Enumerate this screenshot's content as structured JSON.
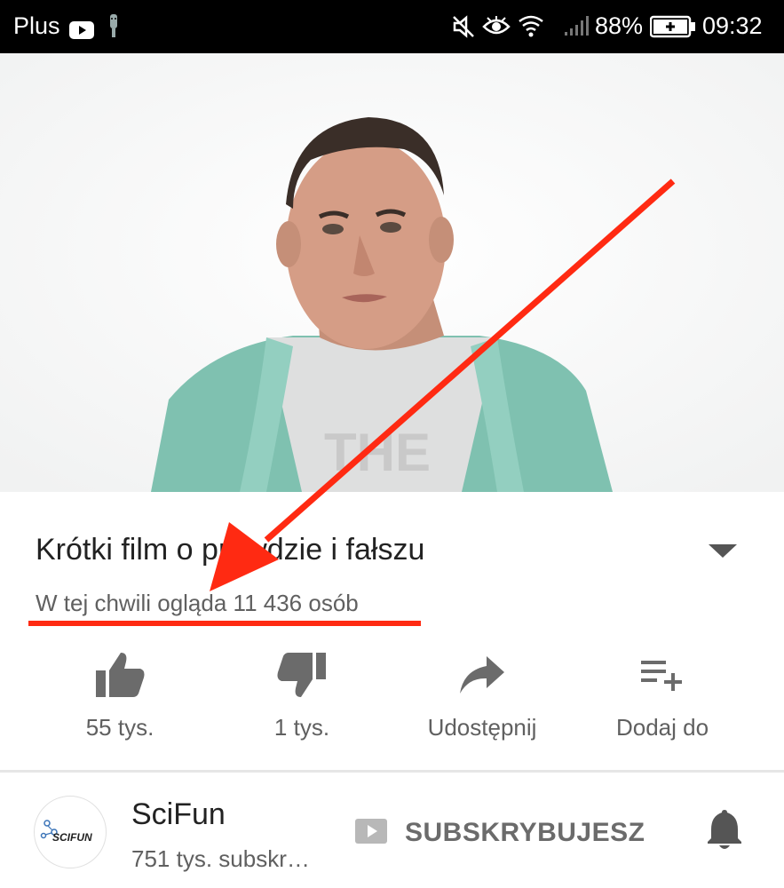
{
  "status_bar": {
    "carrier": "Plus",
    "battery": "88%",
    "time": "09:32",
    "icons": [
      "youtube-icon",
      "usb-debug-icon",
      "mute-icon",
      "eye-icon",
      "wifi-icon",
      "signal-icon",
      "battery-icon"
    ]
  },
  "video": {
    "title": "Krótki film o prawdzie i fałszu",
    "live_viewers": "W tej chwili ogląda 11 436 osób"
  },
  "actions": [
    {
      "label": "55 tys.",
      "icon": "like-icon"
    },
    {
      "label": "1 tys.",
      "icon": "dislike-icon"
    },
    {
      "label": "Udostępnij",
      "icon": "share-icon"
    },
    {
      "label": "Dodaj do",
      "icon": "add-to-playlist-icon"
    }
  ],
  "channel": {
    "name": "SciFun",
    "subscribers": "751 tys. subskr…",
    "logo_text": "SCIFUN",
    "subscribe_label": "SUBSKRYBUJESZ"
  },
  "colors": {
    "annotation": "#ff2a12",
    "text_primary": "#222222",
    "text_secondary": "#606060",
    "icon_gray": "#6b6b6b"
  }
}
